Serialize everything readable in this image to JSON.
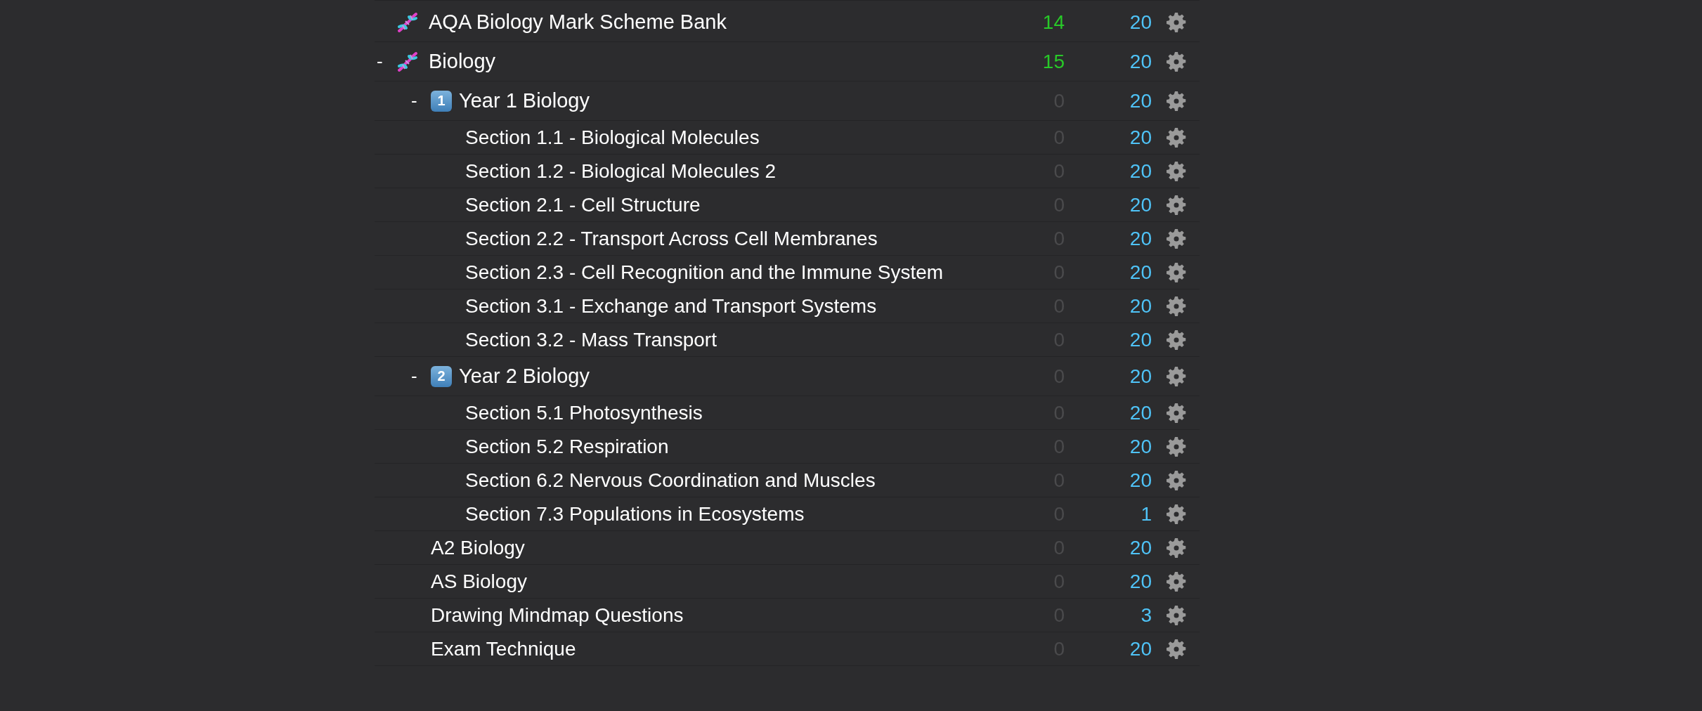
{
  "decks": [
    {
      "name": "AQA Biology Mark Scheme Bank",
      "kind": "dna",
      "due": "14",
      "due_dim": false,
      "new": "20"
    },
    {
      "name": "Biology",
      "toggle": "-",
      "kind": "dna",
      "due": "15",
      "due_dim": false,
      "new": "20",
      "children": [
        {
          "name": "Year 1 Biology",
          "toggle": "-",
          "keycap": "1",
          "due": "0",
          "due_dim": true,
          "new": "20",
          "children": [
            {
              "name": "Section 1.1 - Biological Molecules",
              "due": "0",
              "due_dim": true,
              "new": "20"
            },
            {
              "name": "Section 1.2 - Biological Molecules 2",
              "due": "0",
              "due_dim": true,
              "new": "20"
            },
            {
              "name": "Section 2.1 - Cell Structure",
              "due": "0",
              "due_dim": true,
              "new": "20"
            },
            {
              "name": "Section 2.2 - Transport Across Cell Membranes",
              "due": "0",
              "due_dim": true,
              "new": "20"
            },
            {
              "name": "Section 2.3 - Cell Recognition and the Immune System",
              "due": "0",
              "due_dim": true,
              "new": "20"
            },
            {
              "name": "Section 3.1 - Exchange and Transport Systems",
              "due": "0",
              "due_dim": true,
              "new": "20"
            },
            {
              "name": "Section 3.2 - Mass Transport",
              "due": "0",
              "due_dim": true,
              "new": "20"
            }
          ]
        },
        {
          "name": "Year 2 Biology",
          "toggle": "-",
          "keycap": "2",
          "due": "0",
          "due_dim": true,
          "new": "20",
          "children": [
            {
              "name": "Section 5.1 Photosynthesis",
              "due": "0",
              "due_dim": true,
              "new": "20"
            },
            {
              "name": "Section 5.2 Respiration",
              "due": "0",
              "due_dim": true,
              "new": "20"
            },
            {
              "name": "Section 6.2 Nervous Coordination and Muscles",
              "due": "0",
              "due_dim": true,
              "new": "20"
            },
            {
              "name": "Section 7.3 Populations in Ecosystems",
              "due": "0",
              "due_dim": true,
              "new": "1"
            }
          ]
        },
        {
          "name": "A2 Biology",
          "due": "0",
          "due_dim": true,
          "new": "20"
        },
        {
          "name": "AS Biology",
          "due": "0",
          "due_dim": true,
          "new": "20"
        },
        {
          "name": "Drawing Mindmap Questions",
          "due": "0",
          "due_dim": true,
          "new": "3"
        },
        {
          "name": "Exam Technique",
          "due": "0",
          "due_dim": true,
          "new": "20"
        }
      ]
    }
  ]
}
